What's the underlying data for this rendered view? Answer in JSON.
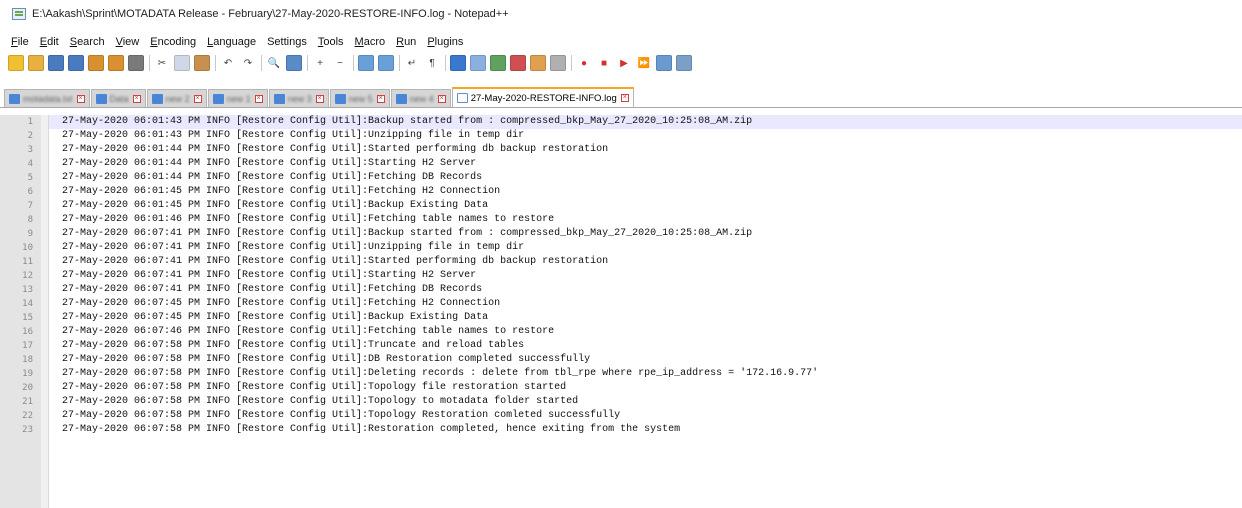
{
  "window": {
    "title": "E:\\Aakash\\Sprint\\MOTADATA Release - February\\27-May-2020-RESTORE-INFO.log - Notepad++"
  },
  "menu": [
    {
      "mnemonic": "F",
      "rest": "ile"
    },
    {
      "mnemonic": "E",
      "rest": "dit"
    },
    {
      "mnemonic": "S",
      "rest": "earch"
    },
    {
      "mnemonic": "V",
      "rest": "iew"
    },
    {
      "mnemonic": "E",
      "rest": "ncoding"
    },
    {
      "mnemonic": "L",
      "rest": "anguage"
    },
    {
      "mnemonic": "",
      "rest": "Settings"
    },
    {
      "mnemonic": "T",
      "rest": "ools"
    },
    {
      "mnemonic": "M",
      "rest": "acro"
    },
    {
      "mnemonic": "R",
      "rest": "un"
    },
    {
      "mnemonic": "P",
      "rest": "lugins"
    }
  ],
  "toolbar": [
    {
      "icon": "new-file-icon",
      "color": "#f0c030",
      "glyph": ""
    },
    {
      "icon": "open-file-icon",
      "color": "#e8b040",
      "glyph": ""
    },
    {
      "icon": "save-icon",
      "color": "#4a7bc0",
      "glyph": ""
    },
    {
      "icon": "save-all-icon",
      "color": "#4a7bc0",
      "glyph": ""
    },
    {
      "icon": "close-icon",
      "color": "#d89030",
      "glyph": ""
    },
    {
      "icon": "close-all-icon",
      "color": "#d89030",
      "glyph": ""
    },
    {
      "icon": "print-icon",
      "color": "#7a7a7a",
      "glyph": ""
    },
    {
      "sep": true
    },
    {
      "icon": "cut-icon",
      "color": "#ffffff",
      "glyph": "✂"
    },
    {
      "icon": "copy-icon",
      "color": "#d0d8e8",
      "glyph": ""
    },
    {
      "icon": "paste-icon",
      "color": "#c89050",
      "glyph": ""
    },
    {
      "sep": true
    },
    {
      "icon": "undo-icon",
      "color": "#ffffff",
      "glyph": "↶"
    },
    {
      "icon": "redo-icon",
      "color": "#ffffff",
      "glyph": "↷"
    },
    {
      "sep": true
    },
    {
      "icon": "find-icon",
      "color": "#ffffff",
      "glyph": "🔍"
    },
    {
      "icon": "replace-icon",
      "color": "#5a8ac8",
      "glyph": ""
    },
    {
      "sep": true
    },
    {
      "icon": "zoom-in-icon",
      "color": "#ffffff",
      "glyph": "+"
    },
    {
      "icon": "zoom-out-icon",
      "color": "#ffffff",
      "glyph": "−"
    },
    {
      "sep": true
    },
    {
      "icon": "sync-vertical-icon",
      "color": "#6aa0d8",
      "glyph": ""
    },
    {
      "icon": "sync-horizontal-icon",
      "color": "#6aa0d8",
      "glyph": ""
    },
    {
      "sep": true
    },
    {
      "icon": "word-wrap-icon",
      "color": "#ffffff",
      "glyph": "↵"
    },
    {
      "icon": "show-all-chars-icon",
      "color": "#ffffff",
      "glyph": "¶"
    },
    {
      "sep": true
    },
    {
      "icon": "indent-guide-icon",
      "color": "#3a78d0",
      "glyph": ""
    },
    {
      "icon": "user-language-icon",
      "color": "#8ab0e0",
      "glyph": ""
    },
    {
      "icon": "doc-map-icon",
      "color": "#60a060",
      "glyph": ""
    },
    {
      "icon": "function-list-icon",
      "color": "#d05050",
      "glyph": ""
    },
    {
      "icon": "folder-workspace-icon",
      "color": "#e0a050",
      "glyph": ""
    },
    {
      "icon": "monitoring-icon",
      "color": "#b0b0b0",
      "glyph": ""
    },
    {
      "sep": true
    },
    {
      "icon": "record-macro-icon",
      "color": "#ffffff",
      "glyph": "●"
    },
    {
      "icon": "stop-record-icon",
      "color": "#ffffff",
      "glyph": "■"
    },
    {
      "icon": "play-macro-icon",
      "color": "#ffffff",
      "glyph": "▶"
    },
    {
      "icon": "run-macro-multiple-icon",
      "color": "#ffffff",
      "glyph": "⏩"
    },
    {
      "icon": "save-macro-icon",
      "color": "#6a9ad0",
      "glyph": ""
    },
    {
      "icon": "spell-check-icon",
      "color": "#7aa0c8",
      "glyph": ""
    }
  ],
  "tabs": [
    {
      "label": "motadata.txt",
      "active": false
    },
    {
      "label": "Data",
      "active": false
    },
    {
      "label": "new 2",
      "active": false
    },
    {
      "label": "new 1",
      "active": false
    },
    {
      "label": "new 3",
      "active": false
    },
    {
      "label": "new 5",
      "active": false
    },
    {
      "label": "new 4",
      "active": false
    },
    {
      "label": "27-May-2020-RESTORE-INFO.log",
      "active": true
    }
  ],
  "editor": {
    "current_line": 1,
    "lines": [
      {
        "n": "1",
        "text": "27-May-2020 06:01:43 PM INFO [Restore Config Util]:Backup started from : compressed_bkp_May_27_2020_10:25:08_AM.zip"
      },
      {
        "n": "2",
        "text": "27-May-2020 06:01:43 PM INFO [Restore Config Util]:Unzipping file in temp dir"
      },
      {
        "n": "3",
        "text": "27-May-2020 06:01:44 PM INFO [Restore Config Util]:Started performing db backup restoration"
      },
      {
        "n": "4",
        "text": "27-May-2020 06:01:44 PM INFO [Restore Config Util]:Starting H2 Server"
      },
      {
        "n": "5",
        "text": "27-May-2020 06:01:44 PM INFO [Restore Config Util]:Fetching DB Records"
      },
      {
        "n": "6",
        "text": "27-May-2020 06:01:45 PM INFO [Restore Config Util]:Fetching H2 Connection"
      },
      {
        "n": "7",
        "text": "27-May-2020 06:01:45 PM INFO [Restore Config Util]:Backup Existing Data"
      },
      {
        "n": "8",
        "text": "27-May-2020 06:01:46 PM INFO [Restore Config Util]:Fetching table names to restore"
      },
      {
        "n": "9",
        "text": "27-May-2020 06:07:41 PM INFO [Restore Config Util]:Backup started from : compressed_bkp_May_27_2020_10:25:08_AM.zip"
      },
      {
        "n": "10",
        "text": "27-May-2020 06:07:41 PM INFO [Restore Config Util]:Unzipping file in temp dir"
      },
      {
        "n": "11",
        "text": "27-May-2020 06:07:41 PM INFO [Restore Config Util]:Started performing db backup restoration"
      },
      {
        "n": "12",
        "text": "27-May-2020 06:07:41 PM INFO [Restore Config Util]:Starting H2 Server"
      },
      {
        "n": "13",
        "text": "27-May-2020 06:07:41 PM INFO [Restore Config Util]:Fetching DB Records"
      },
      {
        "n": "14",
        "text": "27-May-2020 06:07:45 PM INFO [Restore Config Util]:Fetching H2 Connection"
      },
      {
        "n": "15",
        "text": "27-May-2020 06:07:45 PM INFO [Restore Config Util]:Backup Existing Data"
      },
      {
        "n": "16",
        "text": "27-May-2020 06:07:46 PM INFO [Restore Config Util]:Fetching table names to restore"
      },
      {
        "n": "17",
        "text": "27-May-2020 06:07:58 PM INFO [Restore Config Util]:Truncate and reload tables"
      },
      {
        "n": "18",
        "text": "27-May-2020 06:07:58 PM INFO [Restore Config Util]:DB Restoration completed successfully"
      },
      {
        "n": "19",
        "text": "27-May-2020 06:07:58 PM INFO [Restore Config Util]:Deleting records : delete from tbl_rpe where rpe_ip_address = '172.16.9.77'"
      },
      {
        "n": "20",
        "text": "27-May-2020 06:07:58 PM INFO [Restore Config Util]:Topology file restoration started"
      },
      {
        "n": "21",
        "text": "27-May-2020 06:07:58 PM INFO [Restore Config Util]:Topology to motadata folder started"
      },
      {
        "n": "22",
        "text": "27-May-2020 06:07:58 PM INFO [Restore Config Util]:Topology Restoration comleted successfully"
      },
      {
        "n": "23",
        "text": "27-May-2020 06:07:58 PM INFO [Restore Config Util]:Restoration completed, hence exiting from the system"
      }
    ]
  }
}
